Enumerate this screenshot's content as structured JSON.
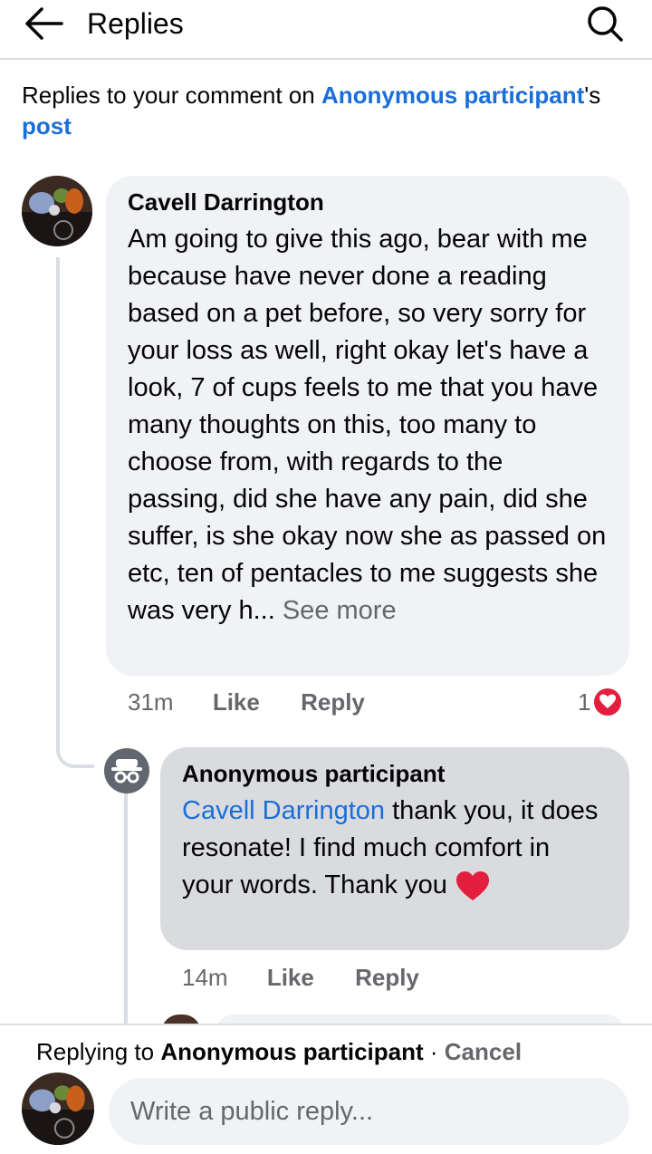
{
  "header": {
    "title": "Replies"
  },
  "context": {
    "prefix": "Replies to your comment on ",
    "author": "Anonymous participant",
    "suffix": "'s",
    "post": "post"
  },
  "comments": [
    {
      "author": "Cavell Darrington",
      "body": "Am going to give this ago, bear with me because have never done a reading based on a pet before, so very sorry for your loss as well, right okay let's have a look, 7 of cups feels to me that you have many thoughts on this, too many to choose from, with regards to the passing, did she have any pain, did she suffer, is she okay now she as passed on etc, ten of pentacles to me suggests she was very h...",
      "see_more": "See more",
      "time": "31m",
      "like": "Like",
      "reply": "Reply",
      "reaction_count": "1"
    },
    {
      "author": "Anonymous participant",
      "mention": "Cavell Darrington",
      "body": " thank you, it does resonate! I find much comfort in your words. Thank you",
      "time": "14m",
      "like": "Like",
      "reply": "Reply"
    }
  ],
  "footer": {
    "replying_prefix": "Replying to ",
    "replying_to": "Anonymous participant",
    "separator": " · ",
    "cancel": "Cancel",
    "placeholder": "Write a public reply..."
  },
  "colors": {
    "link": "#1a6ed8",
    "heart": "#e41e3f",
    "bubble": "#f0f2f5",
    "bubble_highlight": "#d9dbdf"
  },
  "icons": [
    "back-arrow-icon",
    "search-icon",
    "incognito-icon",
    "heart-icon"
  ]
}
